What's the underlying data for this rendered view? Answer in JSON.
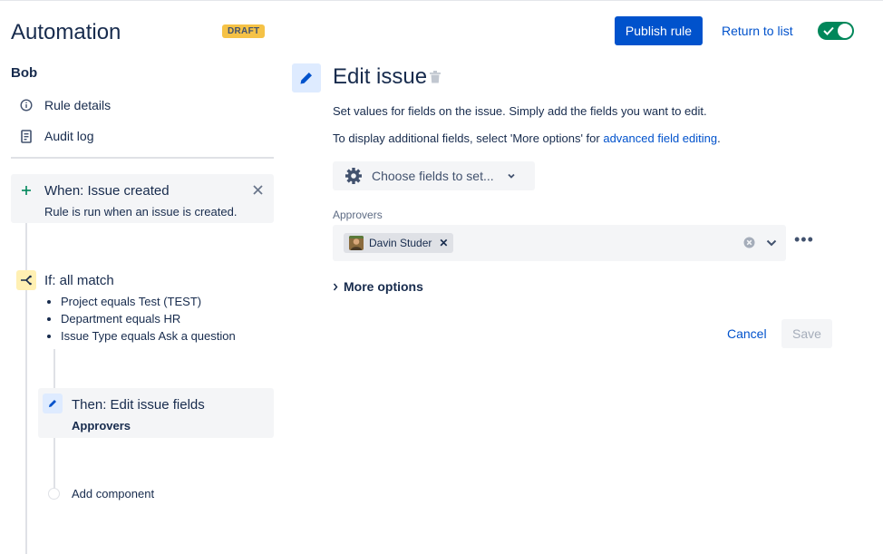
{
  "app": {
    "title": "Automation",
    "status_badge": "DRAFT",
    "rule_name": "Bob"
  },
  "sidebar": {
    "links": [
      {
        "label": "Rule details",
        "icon": "info-icon"
      },
      {
        "label": "Audit log",
        "icon": "document-icon"
      }
    ]
  },
  "flow": {
    "trigger": {
      "title": "When: Issue created",
      "description": "Rule is run when an issue is created."
    },
    "condition": {
      "title": "If: all match",
      "items": [
        "Project equals Test (TEST)",
        "Department equals HR",
        "Issue Type equals Ask a question"
      ]
    },
    "action": {
      "title": "Then: Edit issue fields",
      "detail": "Approvers"
    },
    "add_component": "Add component"
  },
  "header": {
    "publish_label": "Publish rule",
    "return_label": "Return to list",
    "rule_enabled": true
  },
  "panel": {
    "title": "Edit issue",
    "description": "Set values for fields on the issue. Simply add the fields you want to edit.",
    "advanced_prefix": "To display additional fields, select 'More options' for ",
    "advanced_link": "advanced field editing",
    "advanced_suffix": ".",
    "choose_fields_label": "Choose fields to set...",
    "approvers_label": "Approvers",
    "approvers": [
      "Davin Studer"
    ],
    "more_options_label": "More options",
    "cancel_label": "Cancel",
    "save_label": "Save"
  },
  "colors": {
    "primary": "#0052cc",
    "toggle_on": "#00875a",
    "draft_badge": "#f5c246",
    "trigger_icon": "#00875a",
    "condition_bg": "#fff0b3",
    "action_bg": "#deebff"
  }
}
